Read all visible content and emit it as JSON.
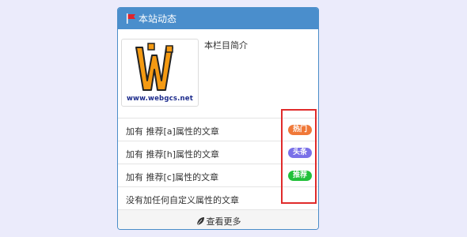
{
  "panel": {
    "title": "本站动态",
    "icon": "flag-icon",
    "intro": {
      "logo_caption": "www.webgcs.net",
      "text": "本栏目简介"
    },
    "items": [
      {
        "title": "加有 推荐[a]属性的文章",
        "badge": "热门",
        "badge_color": "#f07838"
      },
      {
        "title": "加有 推荐[h]属性的文章",
        "badge": "头条",
        "badge_color": "#7a70e8"
      },
      {
        "title": "加有 推荐[c]属性的文章",
        "badge": "推荐",
        "badge_color": "#22c03a"
      },
      {
        "title": "没有加任何自定义属性的文章",
        "badge": null
      }
    ],
    "more_label": "查看更多",
    "more_icon": "leaf-icon"
  },
  "colors": {
    "header": "#4a8ecc",
    "highlight_box": "#e02b2b"
  }
}
